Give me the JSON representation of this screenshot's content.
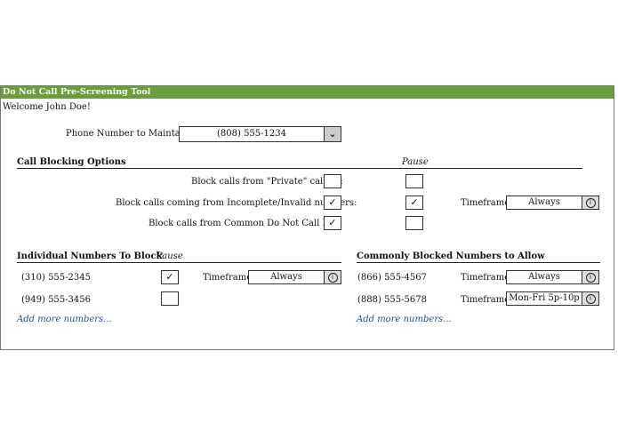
{
  "app": {
    "title": "Do Not Call Pre-Screening Tool",
    "welcome": "Welcome John Doe!"
  },
  "phone": {
    "label": "Phone Number to Maintain:",
    "value": "(808) 555-1234",
    "dropdown_icon": "chevron-down-icon"
  },
  "call_blocking": {
    "heading": "Call Blocking Options",
    "pause_label": "Pause",
    "options": [
      {
        "label": "Block calls from \"Private\" callers:",
        "checked": "",
        "pause": ""
      },
      {
        "label": "Block calls coming from Incomplete/Invalid numbers:",
        "checked": "✓",
        "pause": "✓",
        "timeframe_label": "Timeframe:",
        "timeframe": "Always"
      },
      {
        "label": "Block calls from Common Do Not Call List:",
        "checked": "✓"
      }
    ]
  },
  "individual": {
    "heading": "Individual Numbers To Block",
    "pause_label": "Pause",
    "numbers": [
      {
        "number": "(310) 555-2345",
        "pause": "✓",
        "timeframe_label": "Timeframe:",
        "timeframe": "Always"
      },
      {
        "number": "(949) 555-3456",
        "pause": ""
      }
    ],
    "add_more": "Add more numbers..."
  },
  "allowed": {
    "heading": "Commonly Blocked Numbers to Allow",
    "numbers": [
      {
        "number": "(866) 555-4567",
        "timeframe_label": "Timeframe:",
        "timeframe": "Always"
      },
      {
        "number": "(888) 555-5678",
        "timeframe_label": "Timeframe:",
        "timeframe": "Mon-Fri 5p-10p"
      }
    ],
    "add_more": "Add more numbers..."
  },
  "colors": {
    "titlebar": "#6a9e3a",
    "link": "#1f4e9a"
  }
}
